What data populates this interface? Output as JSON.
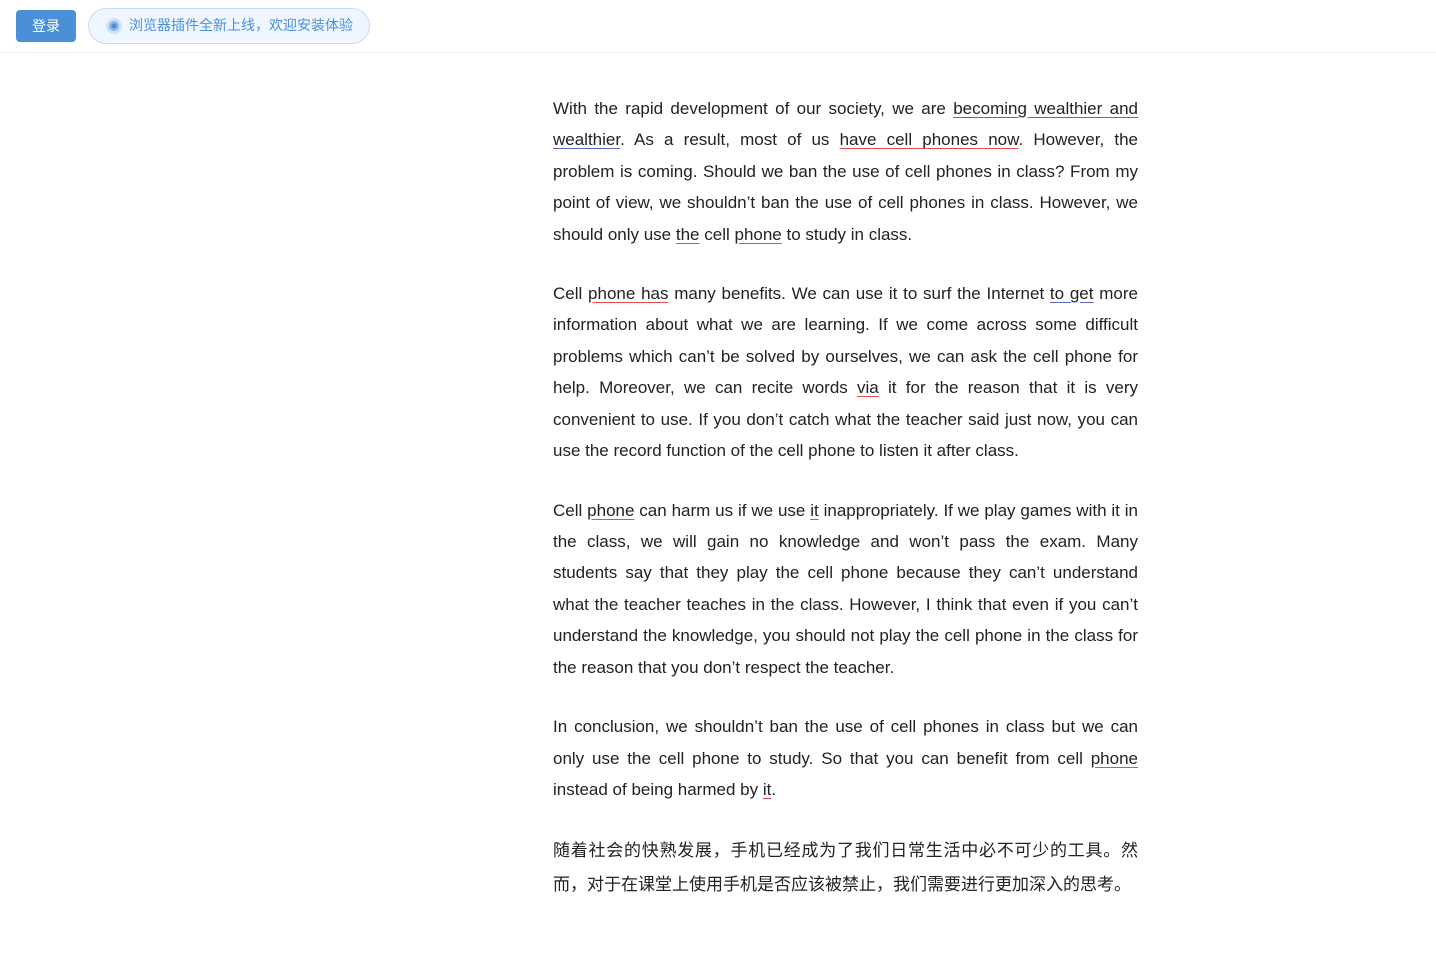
{
  "topbar": {
    "login_label": "登录",
    "plugin_label": "浏览器插件全新上线，欢迎安装体验"
  },
  "paragraphs": [
    {
      "id": "para1",
      "text": "With the rapid development of our society, we are becoming wealthier and wealthier. As a result, most of us have cell phones now. However, the problem is coming. Should we ban the use of cell phones in class? From my point of view, we shouldn’t ban the use of cell phones in class. However, we should only use the cell phone to study in class."
    },
    {
      "id": "para2",
      "text": "Cell phone has many benefits. We can use it to surf the Internet to get more information about what we are learning. If we come across some difficult problems which can’t be solved by ourselves, we can ask the cell phone for help. Moreover, we can recite words via it for the reason that it is very convenient to use. If you don’t catch what the teacher said just now, you can use the record function of the cell phone to listen it after class."
    },
    {
      "id": "para3",
      "text": "Cell phone can harm us if we use it inappropriately. If we play games with it in the class, we will gain no knowledge and won’t pass the exam. Many students say that they play the cell phone because they can’t understand what the teacher teaches in the class. However, I think that even if you can’t understand the knowledge, you should not play the cell phone in the class for the reason that you don’t respect the teacher."
    },
    {
      "id": "para4",
      "text": "In conclusion, we shouldn’t ban the use of cell phones in class but we can only use the cell phone to study. So that you can benefit from cell phone instead of being harmed by it."
    },
    {
      "id": "para5_chinese",
      "text": "随着社会的快熟发展，手机已经成为了我们日常生活中必不可少的工具。然而，对于在课堂上使用手机是否应该被禁止，我们需要进行更加深入的思考。"
    }
  ]
}
